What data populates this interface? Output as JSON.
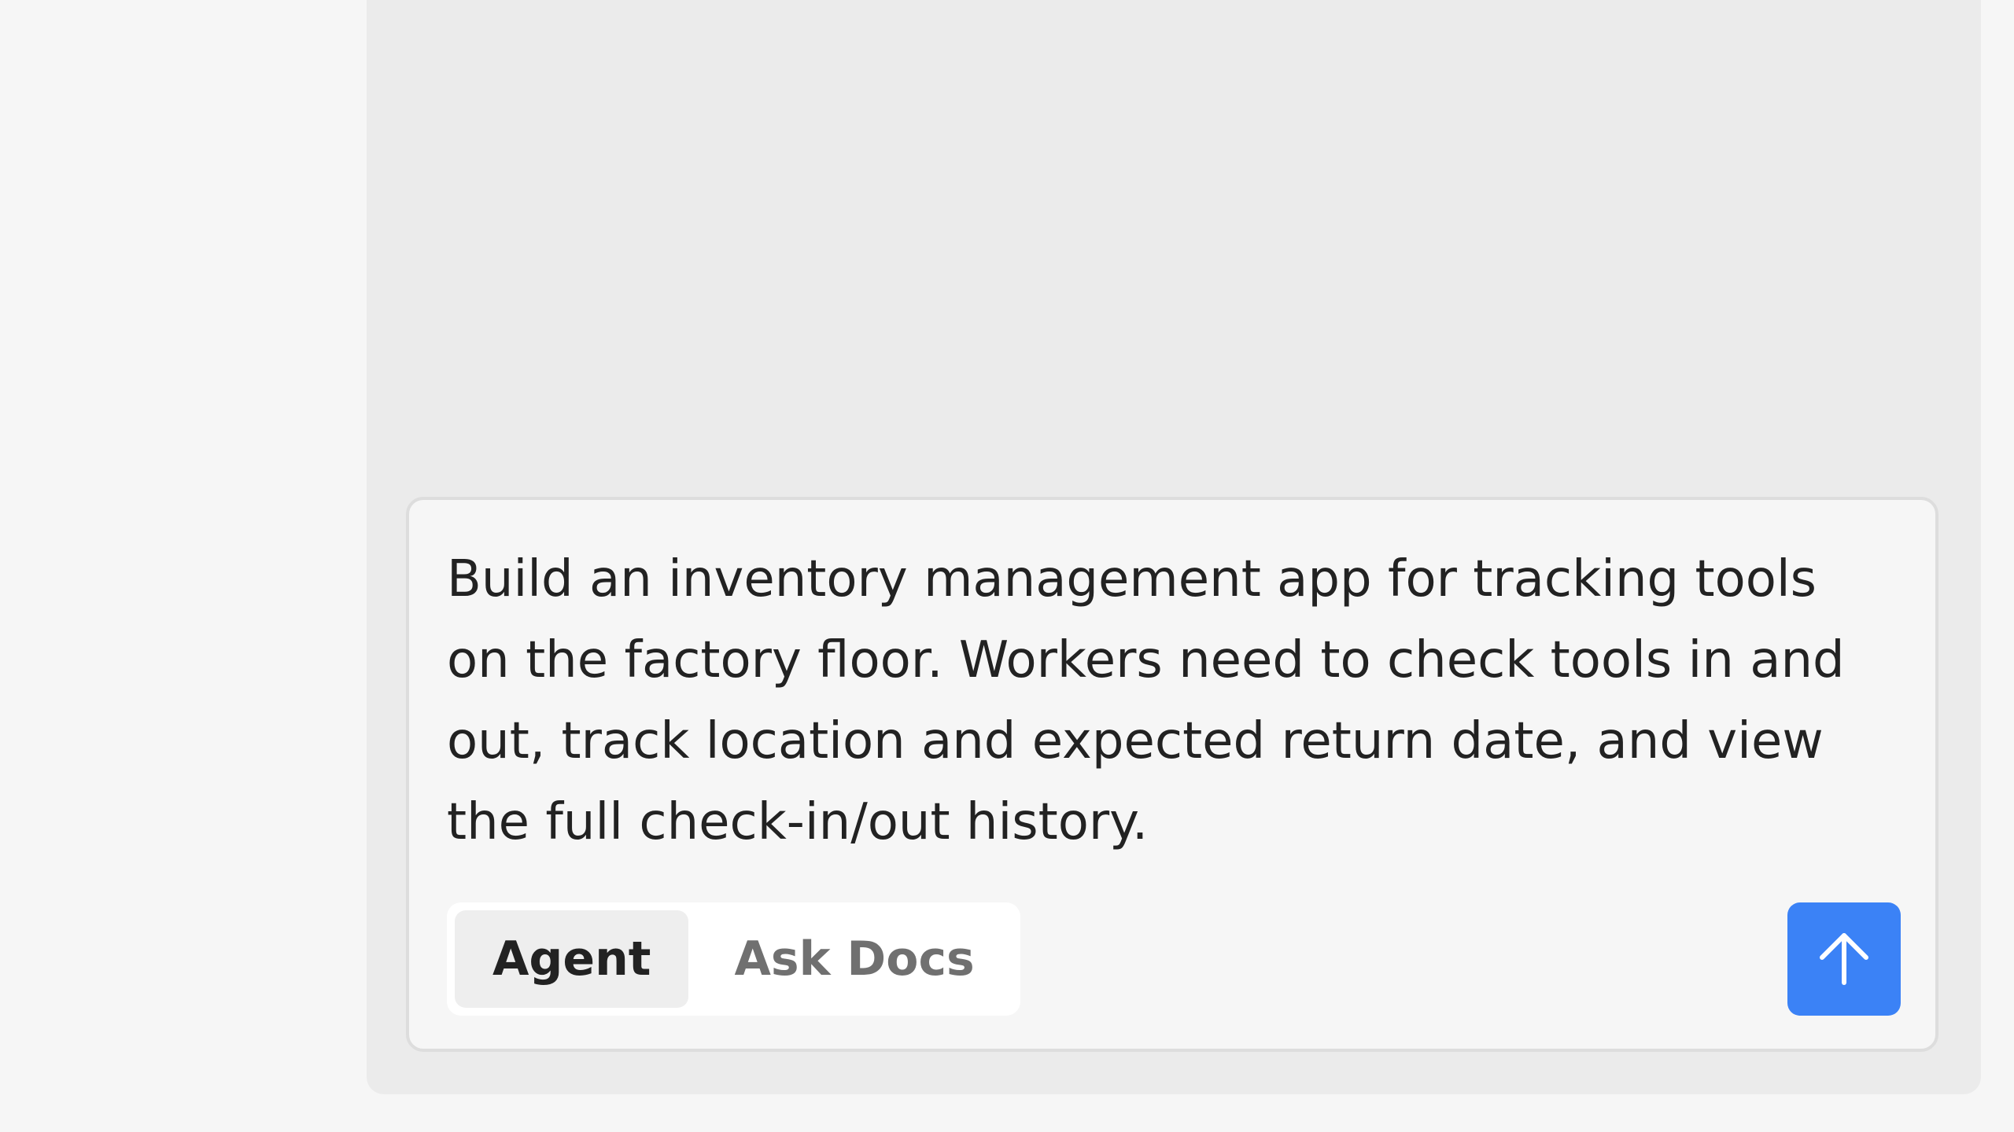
{
  "composer": {
    "prompt_text": "Build an inventory management app for tracking tools on the factory floor. Workers need to check tools in and out, track location and expected return date, and view the full check-in/out history.",
    "modes": [
      {
        "label": "Agent",
        "active": true
      },
      {
        "label": "Ask Docs",
        "active": false
      }
    ],
    "send_icon": "arrow-up-icon"
  },
  "colors": {
    "page_background": "#f6f6f6",
    "panel_background": "#ebebeb",
    "composer_border": "#dddddd",
    "accent": "#3b82f6"
  }
}
